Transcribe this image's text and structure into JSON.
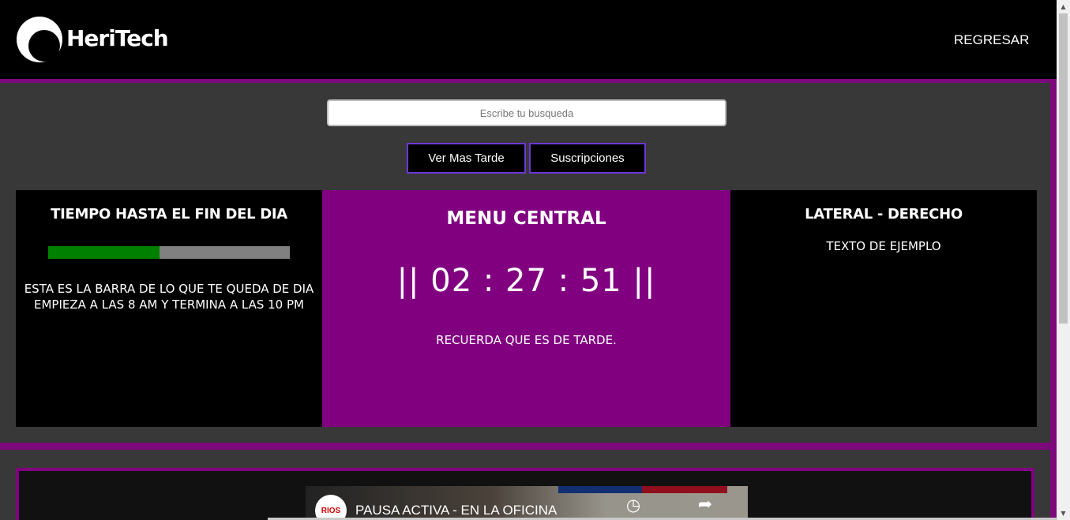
{
  "header": {
    "brand": "HeriTech",
    "back_link": "REGRESAR",
    "logo_icon": "crescent-logo-icon"
  },
  "search": {
    "placeholder": "Escribe tu busqueda"
  },
  "buttons": {
    "watch_later": "Ver Mas Tarde",
    "subscriptions": "Suscripciones"
  },
  "left_panel": {
    "title": "TIEMPO HASTA EL FIN DEL DIA",
    "progress_fraction": 0.46,
    "description_line1": "ESTA ES LA BARRA DE LO QUE TE QUEDA DE DIA",
    "description_line2": "EMPIEZA A LAS 8 AM Y TERMINA A LAS 10 PM"
  },
  "center_panel": {
    "title": "MENU CENTRAL",
    "clock": "|| 02 : 27 : 51 ||",
    "reminder": "RECUERDA QUE ES DE TARDE."
  },
  "right_panel": {
    "title": "LATERAL - DERECHO",
    "text": "TEXTO DE EJEMPLO"
  },
  "video": {
    "channel_badge": "RIOS",
    "title": "PAUSA ACTIVA - EN LA OFICINA",
    "watch_later_icon": "clock-icon",
    "share_icon": "share-icon"
  },
  "colors": {
    "accent": "#800080",
    "header_bg": "#000000",
    "page_bg": "#383838",
    "progress_fill": "#008000",
    "progress_track": "#808080",
    "button_border": "#6e35d6"
  }
}
